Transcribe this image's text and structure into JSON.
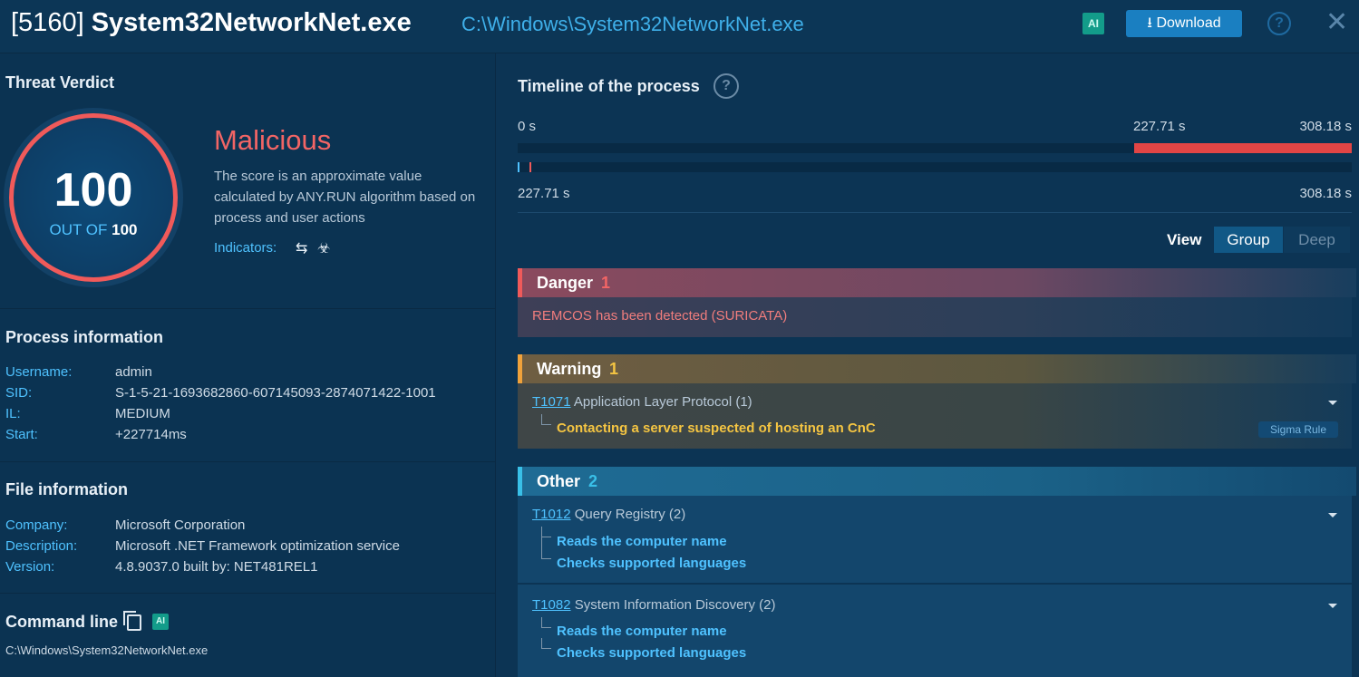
{
  "header": {
    "pid": "[5160]",
    "process_name": "System32NetworkNet.exe",
    "path": "C:\\Windows\\System32NetworkNet.exe",
    "ai_label": "AI",
    "download_label": "Download",
    "help_symbol": "?",
    "close_symbol": "✕"
  },
  "verdict": {
    "section_title": "Threat Verdict",
    "score": "100",
    "out_of_label": "OUT OF",
    "out_of_value": "100",
    "label": "Malicious",
    "description": "The score is an approximate value calculated by ANY.RUN algorithm based on process and user actions",
    "indicators_label": "Indicators:",
    "indicator_icons": [
      "network-arrows-icon",
      "biohazard-icon"
    ]
  },
  "process_info": {
    "title": "Process information",
    "rows": [
      {
        "key": "Username:",
        "value": "admin"
      },
      {
        "key": "SID:",
        "value": "S-1-5-21-1693682860-607145093-2874071422-1001"
      },
      {
        "key": "IL:",
        "value": "MEDIUM"
      },
      {
        "key": "Start:",
        "value": "+227714ms"
      }
    ]
  },
  "file_info": {
    "title": "File information",
    "rows": [
      {
        "key": "Company:",
        "value": "Microsoft Corporation"
      },
      {
        "key": "Description:",
        "value": "Microsoft .NET Framework optimization service"
      },
      {
        "key": "Version:",
        "value": "4.8.9037.0 built by: NET481REL1"
      }
    ]
  },
  "command_line": {
    "title": "Command line",
    "ai_label": "AI",
    "value": "C:\\Windows\\System32NetworkNet.exe"
  },
  "timeline": {
    "title": "Timeline of the process",
    "help_symbol": "?",
    "start_label": "0 s",
    "mark_label": "227.71 s",
    "end_label": "308.18 s",
    "total_seconds": 308.18,
    "process_start_seconds": 227.71,
    "zoom_start_label": "227.71 s",
    "zoom_end_label": "308.18 s"
  },
  "view": {
    "label": "View",
    "options": [
      "Group",
      "Deep"
    ],
    "selected": "Group"
  },
  "categories": {
    "danger": {
      "name": "Danger",
      "count": "1",
      "items": [
        "REMCOS has been detected (SURICATA)"
      ]
    },
    "warning": {
      "name": "Warning",
      "count": "1",
      "techniques": [
        {
          "id": "T1071",
          "name": "Application Layer Protocol (1)",
          "behaviors": [
            "Contacting a server suspected of hosting an CnC"
          ],
          "tag": "Sigma Rule"
        }
      ]
    },
    "other": {
      "name": "Other",
      "count": "2",
      "techniques": [
        {
          "id": "T1012",
          "name": "Query Registry (2)",
          "behaviors": [
            "Reads the computer name",
            "Checks supported languages"
          ]
        },
        {
          "id": "T1082",
          "name": "System Information Discovery (2)",
          "behaviors": [
            "Reads the computer name",
            "Checks supported languages"
          ]
        }
      ]
    }
  },
  "colors": {
    "danger": "#f05a5a",
    "warning": "#f0a23b",
    "other": "#39c0e8",
    "accent": "#4fc2ff",
    "warning_text": "#f5c542"
  }
}
